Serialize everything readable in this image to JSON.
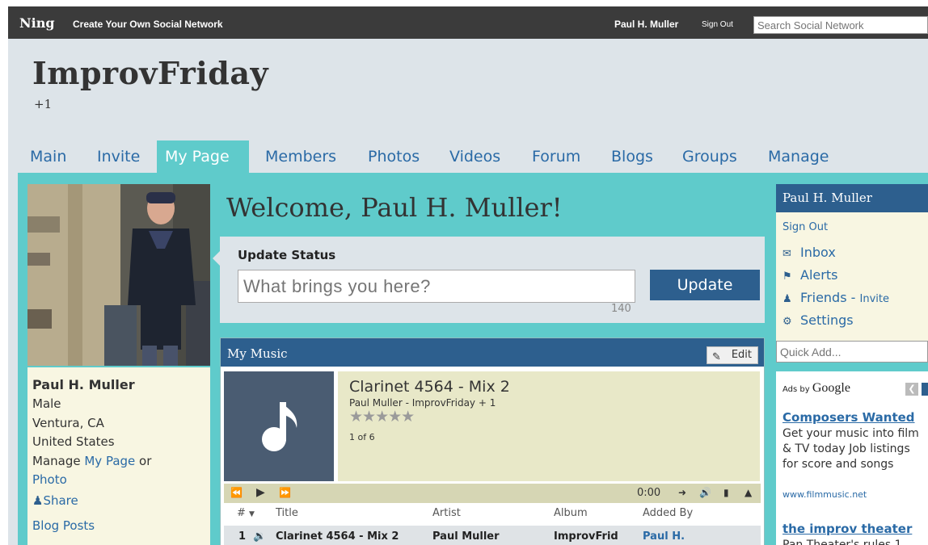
{
  "topbar": {
    "logo": "Ning",
    "create_link": "Create Your Own Social Network",
    "user": "Paul H. Muller",
    "sign_out": "Sign Out",
    "search_placeholder": "Search Social Network"
  },
  "header": {
    "title": "ImprovFriday",
    "subtitle": "+1"
  },
  "nav": {
    "tabs": [
      {
        "label": "Main"
      },
      {
        "label": "Invite"
      },
      {
        "label": "My Page"
      },
      {
        "label": "Members"
      },
      {
        "label": "Photos"
      },
      {
        "label": "Videos"
      },
      {
        "label": "Forum"
      },
      {
        "label": "Blogs"
      },
      {
        "label": "Groups"
      },
      {
        "label": "Manage"
      }
    ],
    "active": "My Page"
  },
  "profile": {
    "name": "Paul H. Muller",
    "gender": "Male",
    "city": "Ventura, CA",
    "country": "United States",
    "manage_prefix": "Manage ",
    "my_page_link": "My Page",
    "or_text": " or",
    "photo_link": "Photo",
    "share": "Share",
    "blog_posts": "Blog Posts"
  },
  "welcome": "Welcome, Paul H. Muller!",
  "status": {
    "label": "Update Status",
    "placeholder": "What brings you here?",
    "char_count": "140",
    "button": "Update"
  },
  "music": {
    "header": "My Music",
    "edit": "Edit",
    "track_title": "Clarinet 4564 - Mix 2",
    "track_artist": "Paul Muller - ImprovFriday + 1",
    "stars": "★★★★★",
    "position": "1 of 6",
    "time": "0:00",
    "columns": {
      "num": "#",
      "title": "Title",
      "artist": "Artist",
      "album": "Album",
      "added_by": "Added By"
    },
    "rows": [
      {
        "num": "1",
        "title": "Clarinet 4564 - Mix 2",
        "artist": "Paul Muller",
        "album": "ImprovFrid",
        "added_by": "Paul H."
      }
    ]
  },
  "sidebar": {
    "user": "Paul H. Muller",
    "sign_out": "Sign Out",
    "inbox": "Inbox",
    "alerts": "Alerts",
    "friends": "Friends",
    "invite_sep": " - ",
    "invite": "Invite",
    "settings": "Settings",
    "quick_add_placeholder": "Quick Add..."
  },
  "ads": {
    "ads_by": "Ads by ",
    "google": "Google",
    "items": [
      {
        "title": "Composers Wanted",
        "text": "Get your music into film & TV today Job listings for score and songs",
        "url": "www.filmmusic.net"
      },
      {
        "title": "the improv theater",
        "text": "Pan Theater's rules 1"
      }
    ]
  },
  "colors": {
    "teal": "#5fcbcb",
    "navy": "#2d5f8e",
    "link": "#2a6aa6",
    "cream": "#f8f6e2"
  }
}
